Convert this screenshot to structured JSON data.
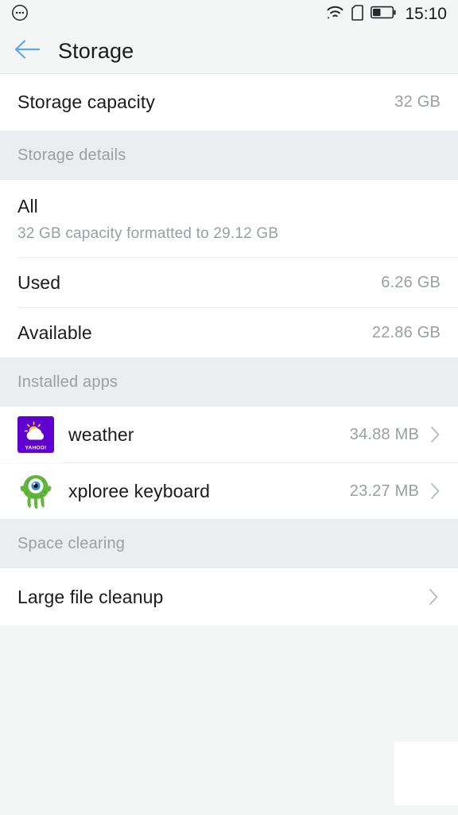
{
  "statusbar": {
    "left_icon": "more-dots-circle-icon",
    "icons": [
      "wifi-icon",
      "sim-card-icon",
      "battery-icon"
    ],
    "time": "15:10"
  },
  "header": {
    "back_icon": "back-arrow-icon",
    "title": "Storage"
  },
  "capacity": {
    "label": "Storage capacity",
    "value": "32 GB"
  },
  "sections": {
    "details_header": "Storage details",
    "installed_apps_header": "Installed apps",
    "space_clearing_header": "Space clearing"
  },
  "details": {
    "all": {
      "title": "All",
      "subtitle": "32 GB capacity formatted to 29.12 GB"
    },
    "rows": [
      {
        "label": "Used",
        "value": "6.26 GB"
      },
      {
        "label": "Available",
        "value": "22.86 GB"
      }
    ]
  },
  "installed_apps": [
    {
      "name": "weather",
      "size": "34.88 MB",
      "icon": "yahoo-weather-icon"
    },
    {
      "name": "xploree keyboard",
      "size": "23.27 MB",
      "icon": "xploree-monster-icon"
    }
  ],
  "space_clearing": {
    "label": "Large file cleanup"
  },
  "colors": {
    "back_arrow": "#5aa9e6",
    "page_background": "#f4f6f6",
    "row_background": "#ffffff",
    "section_background": "#ebeef0",
    "primary_text": "#1b1b1b",
    "secondary_text": "#9aa0a2",
    "yahoo_purple": "#5f01d1",
    "monster_green": "#5fb63b"
  }
}
